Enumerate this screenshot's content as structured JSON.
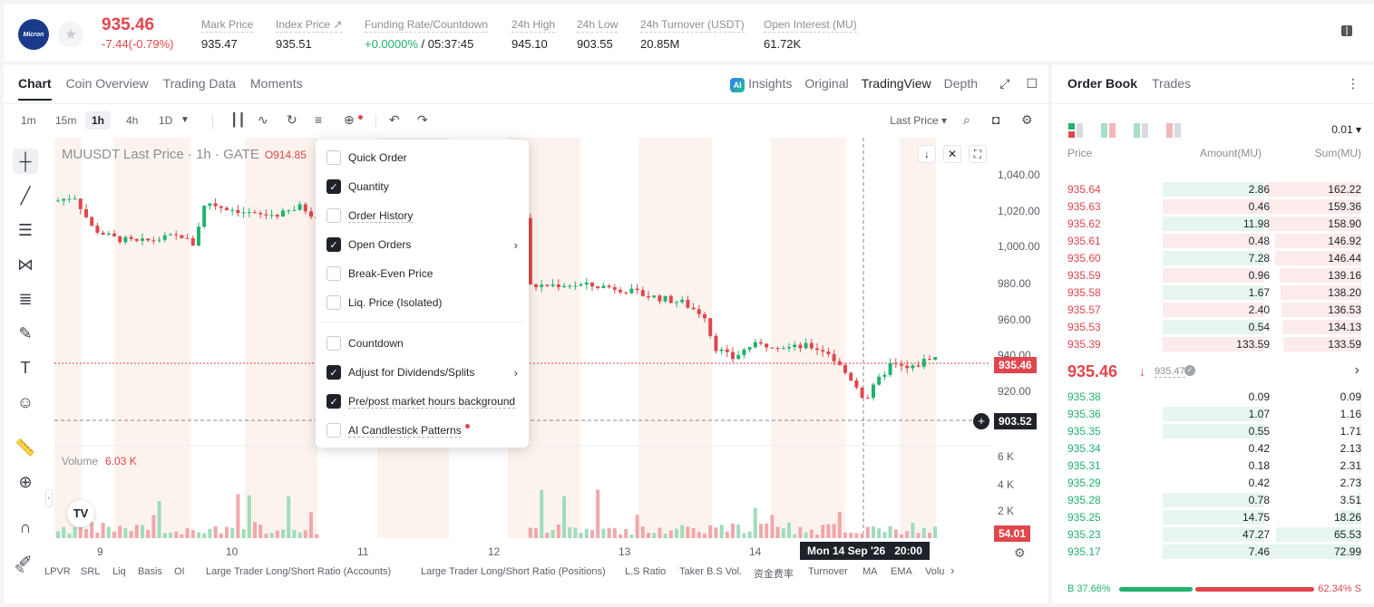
{
  "header": {
    "logo_text": "Micron",
    "last_price": "935.46",
    "change": "-7.44(-0.79%)",
    "stats": [
      {
        "label": "Mark Price",
        "value": "935.47"
      },
      {
        "label": "Index Price ↗",
        "value": "935.51"
      },
      {
        "label": "Funding Rate/Countdown",
        "value_green": "+0.0000%",
        "value_rest": " / 05:37:45"
      },
      {
        "label": "24h High",
        "value": "945.10"
      },
      {
        "label": "24h Low",
        "value": "903.55"
      },
      {
        "label": "24h Turnover (USDT)",
        "value": "20.85M"
      },
      {
        "label": "Open Interest (MU)",
        "value": "61.72K"
      }
    ]
  },
  "chart_panel": {
    "tabs": [
      "Chart",
      "Coin Overview",
      "Trading Data",
      "Moments"
    ],
    "view_tabs": [
      "Insights",
      "Original",
      "TradingView",
      "Depth"
    ],
    "timeframes": [
      "1m",
      "15m",
      "1h",
      "4h",
      "1D"
    ],
    "price_source": "Last Price",
    "series_title": "MUUSDT Last Price · 1h · GATE",
    "series_open": "O914.85",
    "price_axis": [
      "1,040.00",
      "1,020.00",
      "1,000.00",
      "980.00",
      "960.00",
      "940.00",
      "920.00"
    ],
    "volume_axis": [
      "6 K",
      "4 K",
      "2 K"
    ],
    "current_price_tag": "935.46",
    "crosshair_price_tag": "903.52",
    "volume_tag": "54.01",
    "volume_label": "Volume",
    "volume_value": "6.03 K",
    "time_ticks": [
      "9",
      "10",
      "11",
      "12",
      "13",
      "14"
    ],
    "crosshair_time": "Mon 14 Sep '26   20:00",
    "bottom_indicators": [
      "LPVR",
      "SRL",
      "Liq",
      "Basis",
      "OI",
      "Large Trader Long/Short Ratio (Accounts)",
      "Large Trader Long/Short Ratio (Positions)",
      "L.S Ratio",
      "Taker B.S Vol.",
      "资金费率",
      "Turnover",
      "MA",
      "EMA",
      "Volu"
    ]
  },
  "dropdown": {
    "items": [
      {
        "label": "Quick Order",
        "checked": false,
        "underline": false,
        "arrow": false
      },
      {
        "label": "Quantity",
        "checked": true,
        "underline": false,
        "arrow": false
      },
      {
        "label": "Order History",
        "checked": false,
        "underline": true,
        "arrow": false
      },
      {
        "label": "Open Orders",
        "checked": true,
        "underline": false,
        "arrow": true
      },
      {
        "label": "Break-Even Price",
        "checked": false,
        "underline": false,
        "arrow": false
      },
      {
        "label": "Liq. Price (Isolated)",
        "checked": false,
        "underline": false,
        "arrow": false
      },
      {
        "label": "Countdown",
        "checked": false,
        "underline": false,
        "arrow": false
      },
      {
        "label": "Adjust for Dividends/Splits",
        "checked": true,
        "underline": false,
        "arrow": true
      },
      {
        "label": "Pre/post market hours background",
        "checked": true,
        "underline": true,
        "arrow": false
      },
      {
        "label": "AI Candlestick Patterns",
        "checked": false,
        "underline": true,
        "arrow": false
      }
    ]
  },
  "order_book": {
    "tabs": [
      "Order Book",
      "Trades"
    ],
    "precision": "0.01",
    "headers": {
      "price": "Price",
      "amount": "Amount(MU)",
      "sum": "Sum(MU)"
    },
    "asks": [
      {
        "price": "935.64",
        "amount": "2.86",
        "sum": "162.22"
      },
      {
        "price": "935.63",
        "amount": "0.46",
        "sum": "159.36"
      },
      {
        "price": "935.62",
        "amount": "11.98",
        "sum": "158.90"
      },
      {
        "price": "935.61",
        "amount": "0.48",
        "sum": "146.92"
      },
      {
        "price": "935.60",
        "amount": "7.28",
        "sum": "146.44"
      },
      {
        "price": "935.59",
        "amount": "0.96",
        "sum": "139.16"
      },
      {
        "price": "935.58",
        "amount": "1.67",
        "sum": "138.20"
      },
      {
        "price": "935.57",
        "amount": "2.40",
        "sum": "136.53"
      },
      {
        "price": "935.53",
        "amount": "0.54",
        "sum": "134.13"
      },
      {
        "price": "935.39",
        "amount": "133.59",
        "sum": "133.59"
      }
    ],
    "mid_price": "935.46",
    "mark_price": "935.47",
    "bids": [
      {
        "price": "935.38",
        "amount": "0.09",
        "sum": "0.09"
      },
      {
        "price": "935.36",
        "amount": "1.07",
        "sum": "1.16"
      },
      {
        "price": "935.35",
        "amount": "0.55",
        "sum": "1.71"
      },
      {
        "price": "935.34",
        "amount": "0.42",
        "sum": "2.13"
      },
      {
        "price": "935.31",
        "amount": "0.18",
        "sum": "2.31"
      },
      {
        "price": "935.29",
        "amount": "0.42",
        "sum": "2.73"
      },
      {
        "price": "935.28",
        "amount": "0.78",
        "sum": "3.51"
      },
      {
        "price": "935.25",
        "amount": "14.75",
        "sum": "18.26"
      },
      {
        "price": "935.23",
        "amount": "47.27",
        "sum": "65.53"
      },
      {
        "price": "935.17",
        "amount": "7.46",
        "sum": "72.99"
      }
    ],
    "buy_ratio": "B 37.66%",
    "sell_ratio": "62.34% S",
    "buy_fraction": 0.3766
  },
  "colors": {
    "up": "#21b26d",
    "down": "#e0464c"
  }
}
